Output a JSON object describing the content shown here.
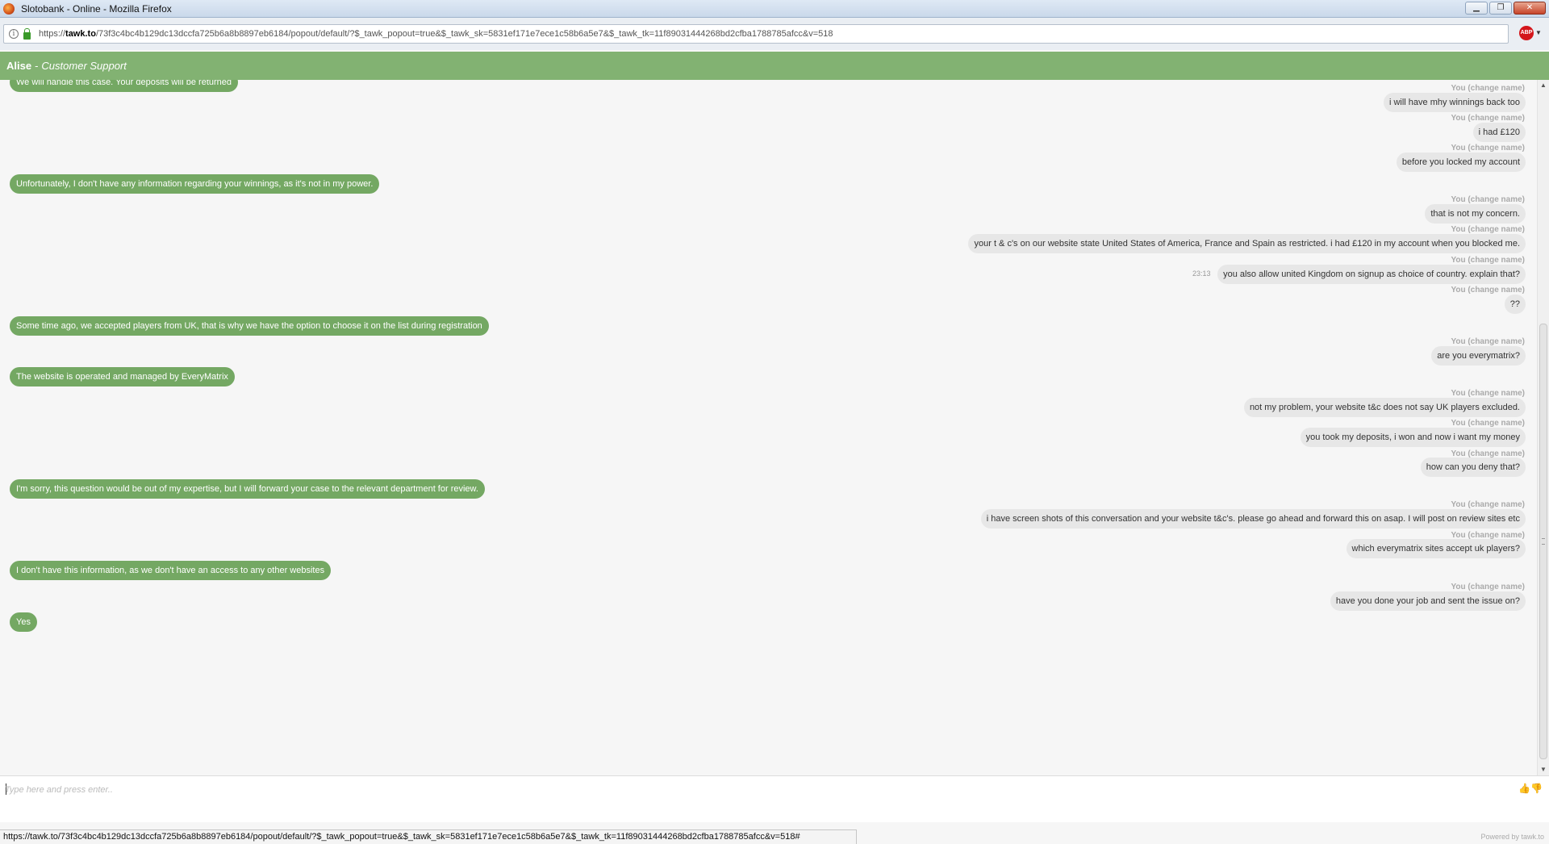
{
  "window": {
    "title": "Slotobank - Online - Mozilla Firefox",
    "buttons": {
      "minimize": "▁",
      "restore": "❐",
      "close": "✕"
    }
  },
  "browser": {
    "url_prefix": "https://",
    "url_domain": "tawk.to",
    "url_rest": "/73f3c4bc4b129dc13dccfa725b6a8b8897eb6184/popout/default/?$_tawk_popout=true&$_tawk_sk=5831ef171e7ece1c58b6a5e7&$_tawk_tk=11f89031444268bd2cfba1788785afcc&v=518",
    "addon_label": "ABP",
    "icons": [
      "info-icon",
      "lock-icon",
      "adblock-icon"
    ]
  },
  "chat_header": {
    "agent_name": "Alise",
    "separator": "-",
    "agent_role": "Customer Support"
  },
  "messages": {
    "agent": [
      "We will handle this case. Your deposits will be returned",
      "Unfortunately, I don't have any information regarding your winnings, as it's not in my power.",
      "Some time ago, we accepted players from UK, that is why we have the option to choose it on the list during registration",
      "The website is operated and managed by EveryMatrix",
      "I'm sorry, this question would be out of my expertise, but I will forward your case to the relevant department for review.",
      "I don't have this information, as we don't have an access to any other websites",
      "Yes"
    ],
    "user_label": "You (change name)",
    "user": [
      "i will have mhy winnings back too",
      "i had £120",
      "before you locked my account",
      "that is not my concern.",
      "your t & c's on our website state United States of America, France and Spain as restricted. i had £120 in my account when you blocked  me.",
      "you also allow united Kingdom on signup as choice of country. explain that?",
      "??",
      "are you everymatrix?",
      "not my problem, your website t&c does not say UK players excluded.",
      "you took my deposits, i won and now i want my money",
      "how can you deny that?",
      "i have screen shots of this conversation and your website t&c's. please go ahead and forward this on asap. I will post on review sites etc",
      "which everymatrix sites accept uk players?",
      "have you done your job and sent the issue on?"
    ],
    "timestamp": "23:13"
  },
  "composer": {
    "placeholder": "Type here and press enter..",
    "icons": [
      "thumbs-up-icon",
      "thumbs-down-icon"
    ],
    "thumb_up": "👍",
    "thumb_down": "👎"
  },
  "footer": {
    "status_url": "https://tawk.to/73f3c4bc4b129dc13dccfa725b6a8b8897eb6184/popout/default/?$_tawk_popout=true&$_tawk_sk=5831ef171e7ece1c58b6a5e7&$_tawk_tk=11f89031444268bd2cfba1788785afcc&v=518#",
    "powered_by": "Powered by tawk.to"
  },
  "colors": {
    "header_green": "#82b272",
    "agent_bubble": "#74a863",
    "user_bubble": "#e7e7e7"
  }
}
